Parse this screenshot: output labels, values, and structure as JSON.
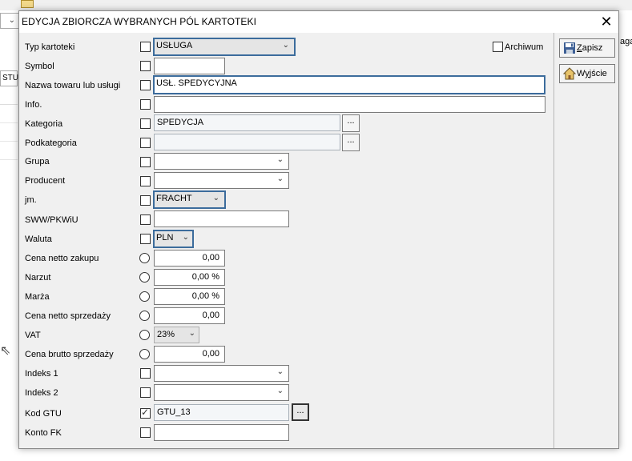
{
  "background": {
    "gtu_label": "STU",
    "right_text": "aga"
  },
  "dialog": {
    "title": "EDYCJA ZBIORCZA WYBRANYCH PÓL KARTOTEKI",
    "close_glyph": "✕"
  },
  "form": {
    "typ_kartoteki": {
      "label": "Typ kartoteki",
      "value": "USŁUGA"
    },
    "archiwum": {
      "label": "Archiwum"
    },
    "symbol": {
      "label": "Symbol",
      "value": ""
    },
    "nazwa": {
      "label": "Nazwa towaru lub usługi",
      "value": "USŁ. SPEDYCYJNA"
    },
    "info": {
      "label": "Info.",
      "value": ""
    },
    "kategoria": {
      "label": "Kategoria",
      "value": "SPEDYCJA",
      "button": "..."
    },
    "podkategoria": {
      "label": "Podkategoria",
      "value": "",
      "button": "..."
    },
    "grupa": {
      "label": "Grupa",
      "value": ""
    },
    "producent": {
      "label": "Producent",
      "value": ""
    },
    "jm": {
      "label": "jm.",
      "value": "FRACHT"
    },
    "sww": {
      "label": "SWW/PKWiU",
      "value": ""
    },
    "waluta": {
      "label": "Waluta",
      "value": "PLN"
    },
    "cena_netto_zakupu": {
      "label": "Cena netto zakupu",
      "value": "0,00"
    },
    "narzut": {
      "label": "Narzut",
      "value": "0,00 %"
    },
    "marza": {
      "label": "Marża",
      "value": "0,00 %"
    },
    "cena_netto_sprzedazy": {
      "label": "Cena netto sprzedaży",
      "value": "0,00"
    },
    "vat": {
      "label": "VAT",
      "value": "23%"
    },
    "cena_brutto_sprzedazy": {
      "label": "Cena brutto sprzedaży",
      "value": "0,00"
    },
    "indeks1": {
      "label": "Indeks 1",
      "value": ""
    },
    "indeks2": {
      "label": "Indeks 2",
      "value": ""
    },
    "kod_gtu": {
      "label": "Kod GTU",
      "value": "GTU_13",
      "button": "...",
      "checked": true
    },
    "konto_fk": {
      "label": "Konto FK",
      "value": ""
    }
  },
  "side": {
    "save": {
      "mnemonic": "Z",
      "rest": "apisz",
      "icon": "floppy-disk-icon"
    },
    "exit": {
      "pre": "W",
      "mnemonic": "y",
      "rest": "jście",
      "icon": "house-icon"
    }
  },
  "colors": {
    "focus_border": "#3c6c9c",
    "dialog_bg": "#f0f0f0"
  }
}
